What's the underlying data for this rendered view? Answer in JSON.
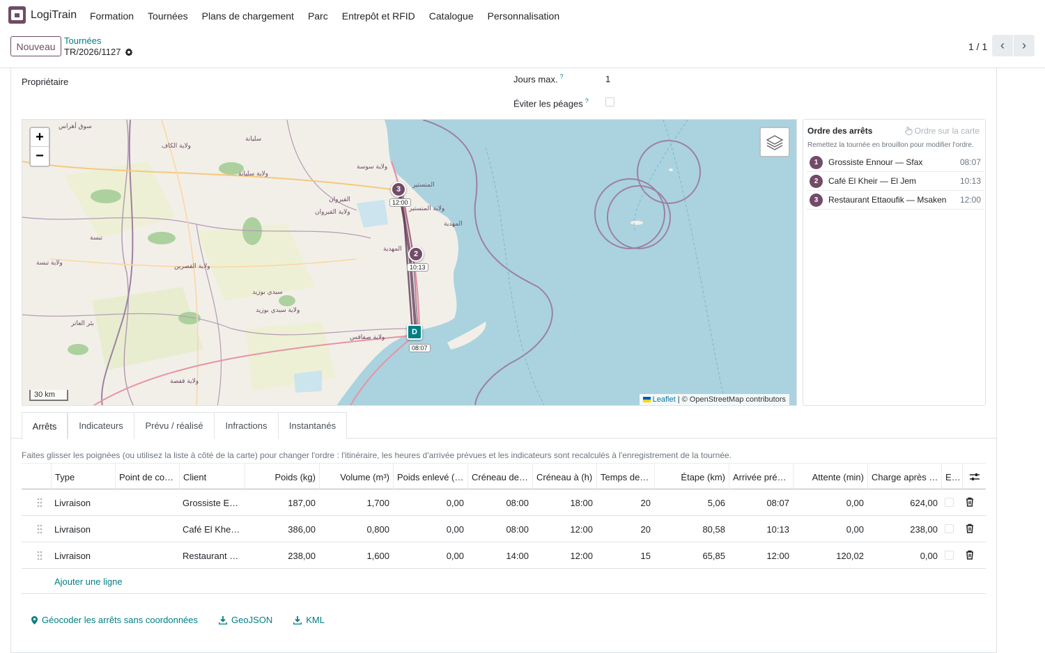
{
  "app": {
    "name": "LogiTrain"
  },
  "menu": [
    "Formation",
    "Tournées",
    "Plans de chargement",
    "Parc",
    "Entrepôt et RFID",
    "Catalogue",
    "Personnalisation"
  ],
  "control": {
    "new_label": "Nouveau",
    "breadcrumb": "Tournées",
    "record": "TR/2026/1127",
    "pager": "1 / 1"
  },
  "form": {
    "owner_label": "Propriétaire",
    "max_days_label": "Jours max.",
    "max_days_value": "1",
    "avoid_tolls_label": "Éviter les péages",
    "help_mark": "?"
  },
  "map": {
    "scale": "30 km",
    "attribution_leaflet": "Leaflet",
    "attribution_rest": " | © OpenStreetMap contributors",
    "markers": [
      {
        "label": "D",
        "time": "08:07"
      },
      {
        "label": "2",
        "time": "10:13"
      },
      {
        "label": "3",
        "time": "12:00"
      }
    ],
    "place_labels": [
      "سوق أهراس",
      "ولاية الكاف",
      "سليانة",
      "ولاية سليانة",
      "ولاية سوسة",
      "المنستير",
      "القيروان",
      "ولاية المنستير",
      "ولاية القيروان",
      "المهدية",
      "تبسة",
      "ولاية تبسة",
      "ولاية القصرين",
      "سيدي بوزيد",
      "ولاية سيدي بوزيد",
      "بئر العاتر",
      "ولاية صفاقس",
      "ولاية قفصة",
      "صفاقس"
    ]
  },
  "stops_panel": {
    "title": "Ordre des arrêts",
    "map_order_label": "Ordre sur la carte",
    "hint": "Remettez la tournée en brouillon pour modifier l'ordre.",
    "stops": [
      {
        "num": "1",
        "name": "Grossiste Ennour — Sfax",
        "time": "08:07"
      },
      {
        "num": "2",
        "name": "Café El Kheir — El Jem",
        "time": "10:13"
      },
      {
        "num": "3",
        "name": "Restaurant Ettaoufik — Msaken",
        "time": "12:00"
      }
    ]
  },
  "tabs": [
    "Arrêts",
    "Indicateurs",
    "Prévu / réalisé",
    "Infractions",
    "Instantanés"
  ],
  "tab_hint": "Faites glisser les poignées (ou utilisez la liste à côté de la carte) pour changer l'ordre : l'itinéraire, les heures d'arrivée prévues et les indicateurs sont recalculés à l'enregistrement de la tournée.",
  "table": {
    "headers": [
      "Type",
      "Point de co…",
      "Client",
      "Poids (kg)",
      "Volume (m³)",
      "Poids enlevé (…",
      "Créneau de…",
      "Créneau à (h)",
      "Temps de…",
      "Étape (km)",
      "Arrivée pré…",
      "Attente (min)",
      "Charge après …",
      "E…"
    ],
    "rows": [
      [
        "Livraison",
        "",
        "Grossiste E…",
        "187,00",
        "1,700",
        "0,00",
        "08:00",
        "18:00",
        "20",
        "5,06",
        "08:07",
        "0,00",
        "624,00"
      ],
      [
        "Livraison",
        "",
        "Café El Khe…",
        "386,00",
        "0,800",
        "0,00",
        "08:00",
        "12:00",
        "20",
        "80,58",
        "10:13",
        "0,00",
        "238,00"
      ],
      [
        "Livraison",
        "",
        "Restaurant …",
        "238,00",
        "1,600",
        "0,00",
        "14:00",
        "12:00",
        "15",
        "65,85",
        "12:00",
        "120,02",
        "0,00"
      ]
    ],
    "add_line": "Ajouter une ligne"
  },
  "actions": [
    "Géocoder les arrêts sans coordonnées",
    "GeoJSON",
    "KML"
  ],
  "colors": {
    "brand": "#714B67",
    "link": "#017e84"
  }
}
